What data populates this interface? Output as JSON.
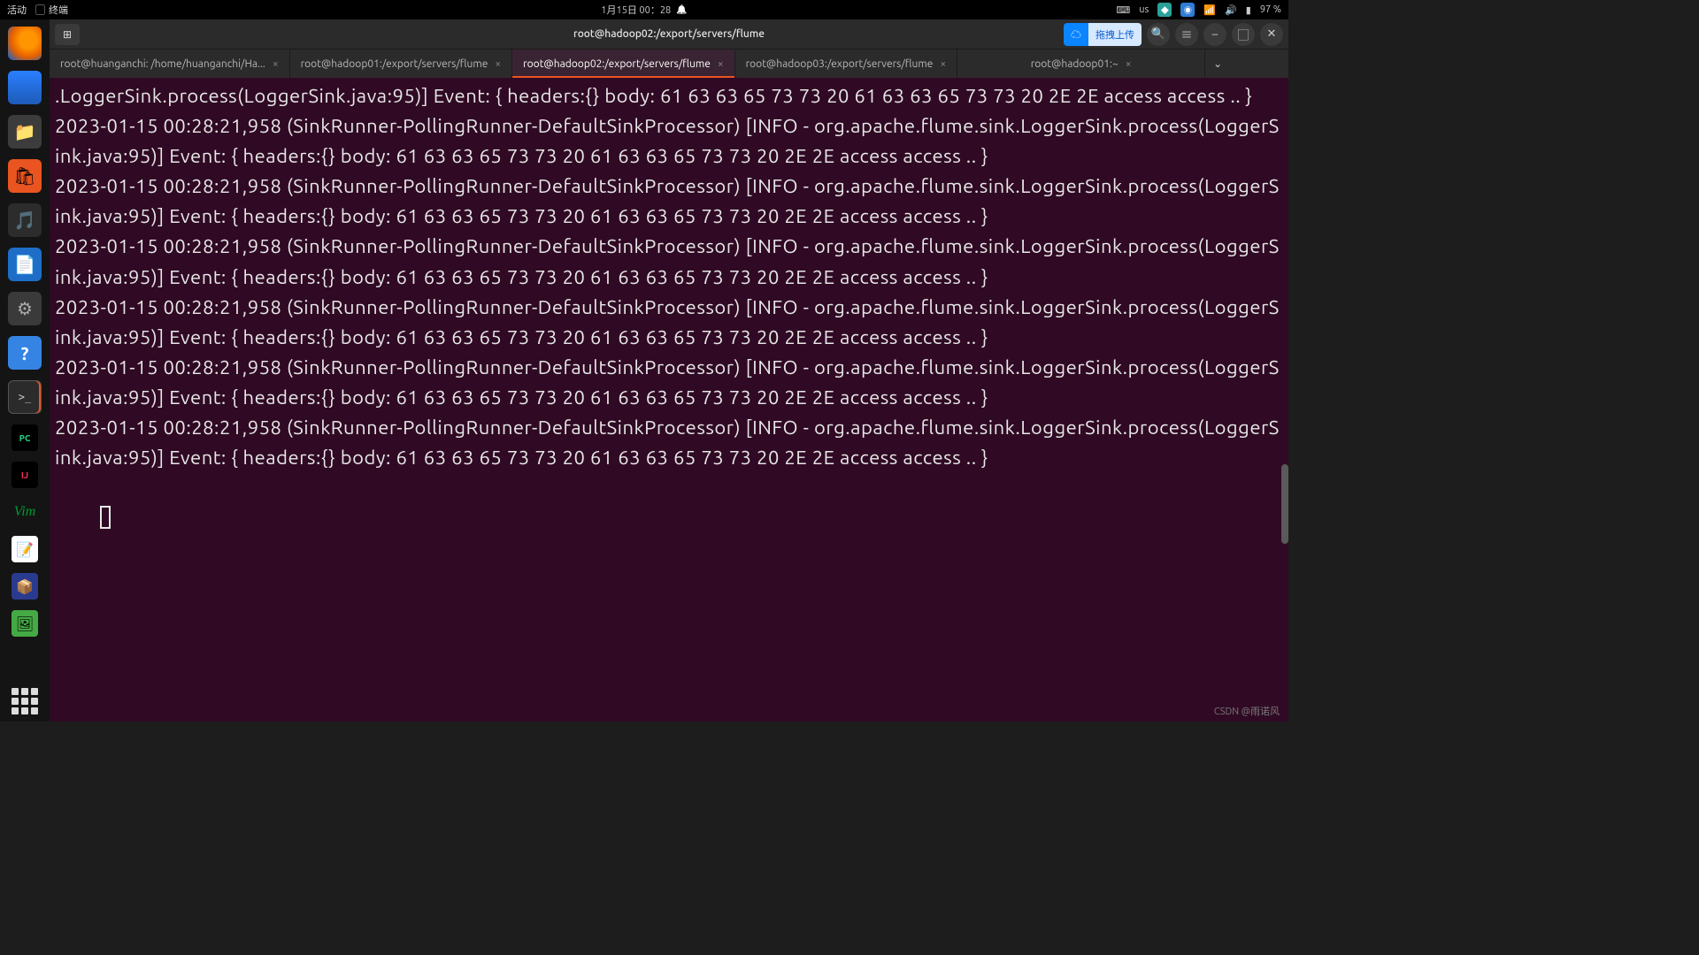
{
  "panel": {
    "activities": "活动",
    "app_label": "终端",
    "clock": "1月15日 00：28",
    "input_indicator": "us",
    "battery": "97 %"
  },
  "dock_icons": [
    {
      "name": "firefox-icon"
    },
    {
      "name": "thunderbird-icon"
    },
    {
      "name": "files-icon"
    },
    {
      "name": "software-store-icon"
    },
    {
      "name": "rhythmbox-icon"
    },
    {
      "name": "writer-icon"
    },
    {
      "name": "settings-icon"
    },
    {
      "name": "help-icon"
    },
    {
      "name": "terminal-icon"
    },
    {
      "name": "pycharm-icon"
    },
    {
      "name": "intellij-icon"
    },
    {
      "name": "vim-icon"
    },
    {
      "name": "gedit-icon"
    },
    {
      "name": "virtualbox-icon"
    },
    {
      "name": "image-viewer-icon"
    }
  ],
  "window": {
    "title": "root@hadoop02:/export/servers/flume",
    "upload_label": "拖拽上传",
    "tabs": [
      {
        "label": "root@huanganchi: /home/huanganchi/Ha...",
        "active": false
      },
      {
        "label": "root@hadoop01:/export/servers/flume",
        "active": false
      },
      {
        "label": "root@hadoop02:/export/servers/flume",
        "active": true
      },
      {
        "label": "root@hadoop03:/export/servers/flume",
        "active": false
      },
      {
        "label": "root@hadoop01:~",
        "active": false
      }
    ]
  },
  "log": {
    "first_fragment": ".LoggerSink.process(LoggerSink.java:95)] Event: { headers:{} body: 61 63 63 65 73 73 20 61 63 63 65 73 73 20 2E 2E access access .. }",
    "entry": "2023-01-15 00:28:21,958 (SinkRunner-PollingRunner-DefaultSinkProcessor) [INFO - org.apache.flume.sink.LoggerSink.process(LoggerSink.java:95)] Event: { headers:{} body: 61 63 63 65 73 73 20 61 63 63 65 73 73 20 2E 2E access access .. }",
    "repeat_count": 6,
    "timestamp": "2023-01-15 00:28:21,958",
    "thread": "SinkRunner-PollingRunner-DefaultSinkProcessor",
    "level": "INFO",
    "logger": "org.apache.flume.sink.LoggerSink.process(LoggerSink.java:95)",
    "body_hex": "61 63 63 65 73 73 20 61 63 63 65 73 73 20 2E 2E",
    "body_ascii": "access access .."
  },
  "watermark": "CSDN @雨诺风"
}
